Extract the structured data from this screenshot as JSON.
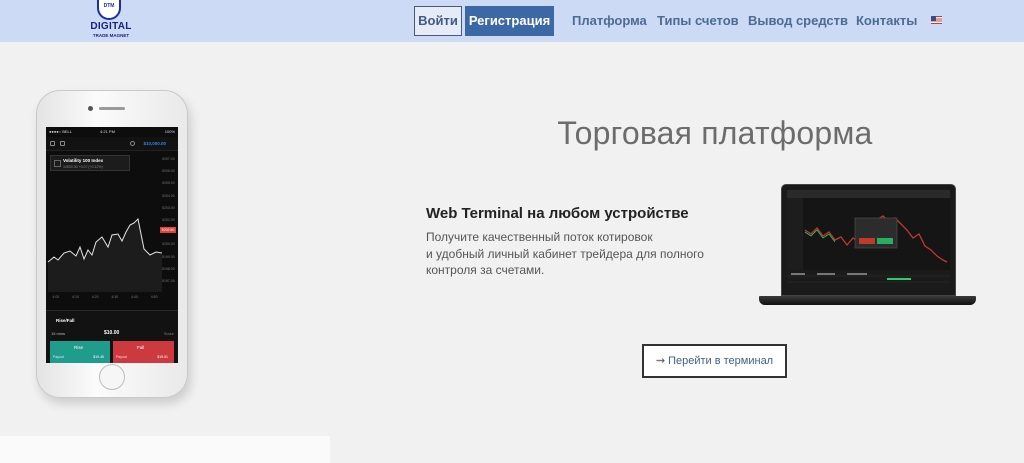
{
  "header": {
    "logo": {
      "title": "DIGITAL",
      "subtitle": "TRADE MAGNET",
      "badge": "DTM"
    },
    "login_label": "Войти",
    "register_label": "Регистрация",
    "nav": [
      "Платформа",
      "Типы счетов",
      "Вывод средств",
      "Контакты"
    ],
    "language_icon": "us-flag-icon"
  },
  "phone": {
    "status_carrier": "●●●●○ BELL ",
    "status_time": "4:21 PM",
    "status_battery": "100%",
    "balance": "$10,000.00",
    "asset_name": "Volatility 100 Index",
    "asset_sub": "10500.30  +0.07 (+0.12%)",
    "price_scale": [
      "5207.00",
      "5206.00",
      "5205.00",
      "5204.00",
      "5203.00",
      "5202.00",
      "5201.00",
      "5200.00",
      "5199.00",
      "5198.00",
      "5197.00"
    ],
    "price_tag": "5202.50",
    "time_axis": [
      "4:00",
      "4:10",
      "4:20",
      "4:30",
      "4:40",
      "4:50"
    ],
    "trade_type": "Rise/Fall",
    "duration": "15 mins",
    "amount": "$10.00",
    "options": "Stake",
    "rise_label": "Rise",
    "rise_payout": "Payout",
    "rise_amount": "$19.45",
    "fall_label": "Fall",
    "fall_payout": "Payout",
    "fall_amount": "$19.51"
  },
  "main": {
    "title": "Торговая платформа",
    "subtitle": "Web Terminal на любом устройстве",
    "desc_lines": [
      "Получите качественный поток котировок",
      "и удобный личный кабинет трейдера для полного",
      "контроля за счетами."
    ],
    "terminal_button": "Перейти в терминал"
  },
  "colors": {
    "header_bg": "#ccdaf6",
    "register_bg": "#3c68a5",
    "nav_text": "#4d6b93",
    "rise": "#1f9c8c",
    "fall": "#cc3a3f"
  }
}
